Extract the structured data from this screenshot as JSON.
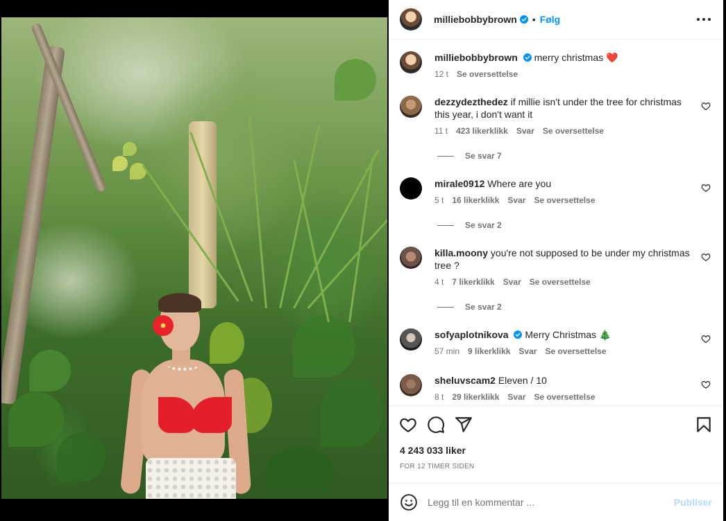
{
  "post": {
    "image_alt": "photo"
  },
  "header": {
    "username": "milliebobbybrown",
    "separator": "•",
    "follow_label": "Følg"
  },
  "caption": {
    "username": "milliebobbybrown",
    "text": "merry christmas",
    "emoji": "❤️",
    "time": "12 t",
    "translate": "Se oversettelse"
  },
  "comments": [
    {
      "username": "dezzydezthedez",
      "text": "if millie isn't under the tree for christmas this year, i don't want it",
      "time": "11 t",
      "likes": "423 likerklikk",
      "reply": "Svar",
      "translate": "Se oversettelse",
      "replies": "Se svar 7",
      "avatar_color": "#8a6a4a"
    },
    {
      "username": "mirale0912",
      "text": "Where are you",
      "time": "5 t",
      "likes": "16 likerklikk",
      "reply": "Svar",
      "translate": "Se oversettelse",
      "replies": "Se svar 2",
      "avatar_color": "#000000"
    },
    {
      "username": "killa.moony",
      "text": "you're not supposed to be under my christmas tree ?",
      "time": "4 t",
      "likes": "7 likerklikk",
      "reply": "Svar",
      "translate": "Se oversettelse",
      "replies": "Se svar 2",
      "avatar_color": "#6b5148"
    },
    {
      "username": "sofyaplotnikova",
      "text": "Merry Christmas",
      "emoji": "🎄",
      "time": "57 min",
      "likes": "9 likerklikk",
      "reply": "Svar",
      "translate": "Se oversettelse",
      "avatar_color": "#3b3b3b"
    },
    {
      "username": "sheluvscam2",
      "text": "Eleven / 10",
      "time": "8 t",
      "likes": "29 likerklikk",
      "reply": "Svar",
      "translate": "Se oversettelse",
      "avatar_color": "#7a5a48"
    }
  ],
  "actions": {
    "like_icon": "heart-icon",
    "comment_icon": "comment-icon",
    "share_icon": "share-icon",
    "save_icon": "bookmark-icon",
    "likes": "4 243 033 liker",
    "time_ago": "FOR 12 TIMER SIDEN"
  },
  "add_comment": {
    "placeholder": "Legg til en kommentar ...",
    "publish_label": "Publiser",
    "emoji_icon": "smiley-icon"
  },
  "colors": {
    "accent": "#0095f6",
    "publish_disabled": "#b3dbff",
    "verified": "#0095f6",
    "heart_red": "#ed4956"
  }
}
